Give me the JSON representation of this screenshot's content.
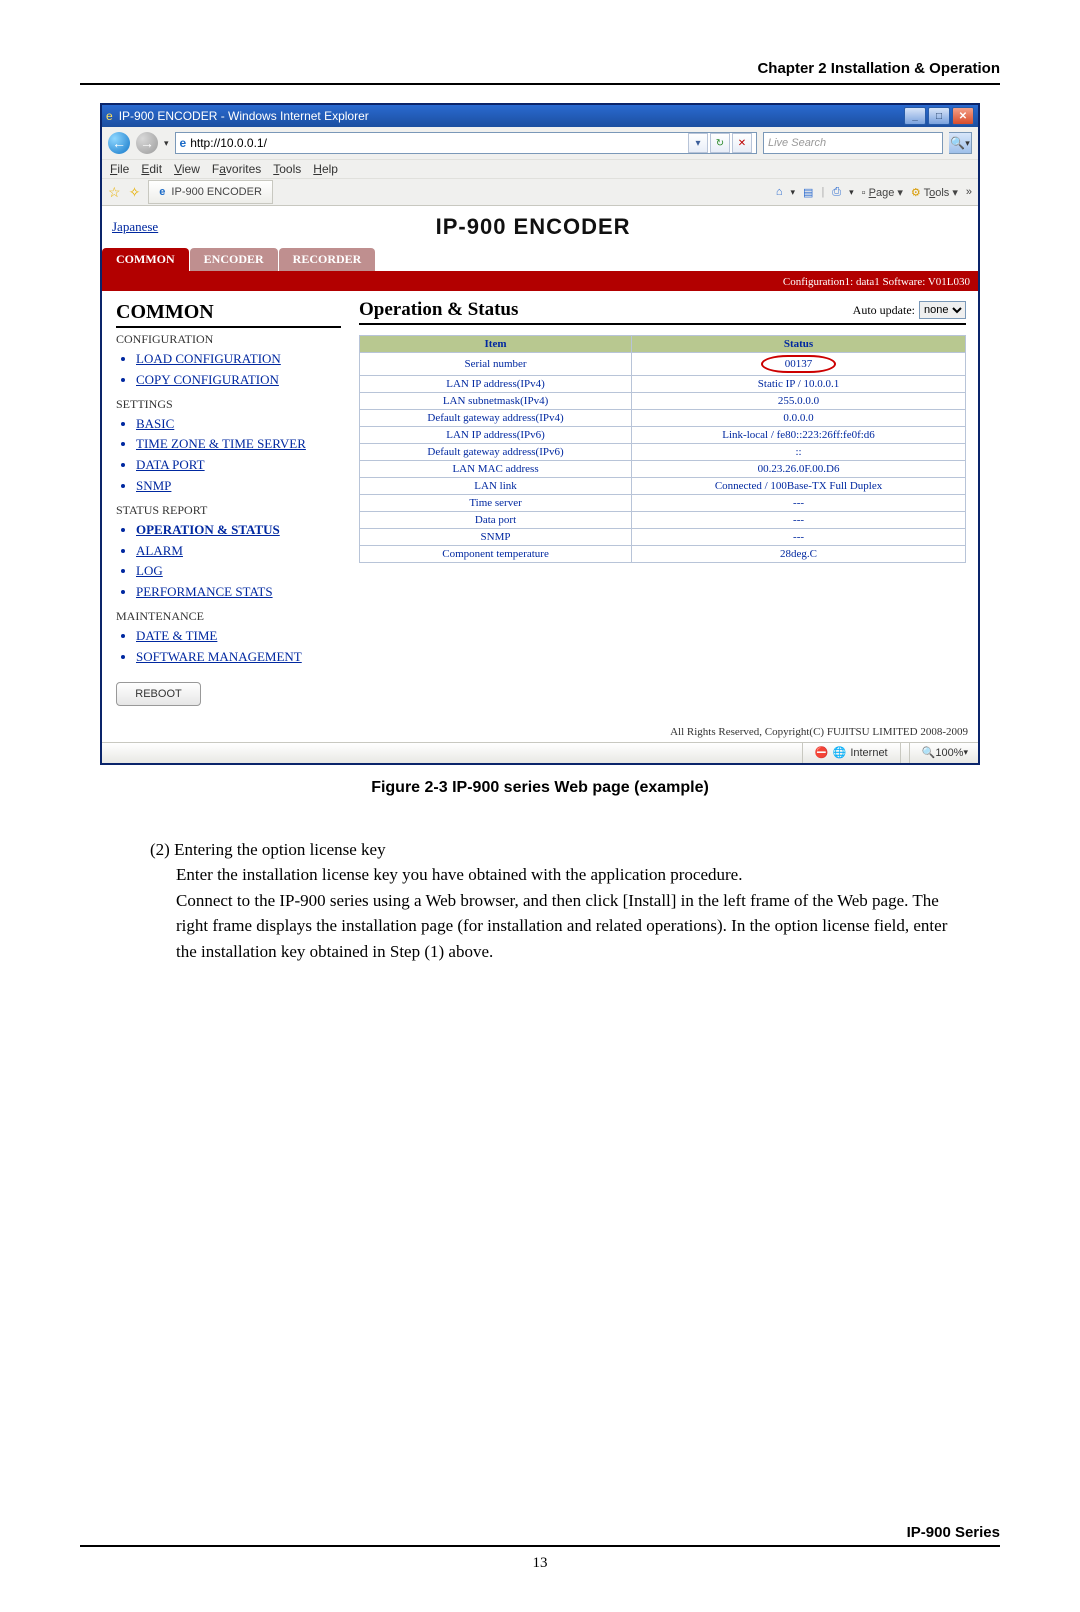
{
  "doc": {
    "chapter_header": "Chapter 2  Installation & Operation",
    "figure_caption": "Figure 2-3 IP-900 series Web page (example)",
    "step_title": "(2) Entering the option license key",
    "para1": "Enter the installation license key you have obtained with the application procedure.",
    "para2": "Connect to the IP-900 series using a Web browser, and then click [Install] in the left frame of the Web page.  The right frame displays the installation page (for installation and related operations).  In the option license field, enter the installation key obtained in Step (1) above.",
    "footer_series": "IP-900 Series",
    "page_number": "13"
  },
  "ie": {
    "title": "IP-900 ENCODER - Windows Internet Explorer",
    "url": "http://10.0.0.1/",
    "search_placeholder": "Live Search",
    "menus": {
      "file": "File",
      "edit": "Edit",
      "view": "View",
      "favorites": "Favorites",
      "tools": "Tools",
      "help": "Help"
    },
    "tab_label": "IP-900 ENCODER",
    "toolbar": {
      "home": "⌂",
      "feed": "▤",
      "print": "⎙",
      "page": "Page",
      "tools": "Tools"
    },
    "status_zone": "Internet",
    "zoom": "100%"
  },
  "webpage": {
    "lang_link": "Japanese",
    "title": "IP-900 ENCODER",
    "top_tabs": {
      "common": "COMMON",
      "encoder": "ENCODER",
      "recorder": "RECORDER"
    },
    "conf_bar": "Configuration1: data1 Software: V01L030",
    "sidebar": {
      "heading": "COMMON",
      "sec_configuration": "CONFIGURATION",
      "conf_items": [
        "LOAD CONFIGURATION",
        "COPY CONFIGURATION"
      ],
      "sec_settings": "SETTINGS",
      "settings_items": [
        "BASIC",
        "TIME ZONE & TIME SERVER",
        "DATA PORT",
        "SNMP"
      ],
      "sec_status": "STATUS REPORT",
      "status_items": [
        "OPERATION & STATUS",
        "ALARM",
        "LOG",
        "PERFORMANCE STATS"
      ],
      "sec_maint": "MAINTENANCE",
      "maint_items": [
        "DATE & TIME",
        "SOFTWARE MANAGEMENT"
      ],
      "reboot_label": "REBOOT"
    },
    "panel": {
      "title": "Operation & Status",
      "auto_update_label": "Auto update:",
      "auto_update_value": "none",
      "th_item": "Item",
      "th_status": "Status",
      "rows": [
        {
          "item": "Serial number",
          "status": "00137"
        },
        {
          "item": "LAN IP address(IPv4)",
          "status": "Static IP / 10.0.0.1"
        },
        {
          "item": "LAN subnetmask(IPv4)",
          "status": "255.0.0.0"
        },
        {
          "item": "Default gateway address(IPv4)",
          "status": "0.0.0.0"
        },
        {
          "item": "LAN IP address(IPv6)",
          "status": "Link-local / fe80::223:26ff:fe0f:d6"
        },
        {
          "item": "Default gateway address(IPv6)",
          "status": "::"
        },
        {
          "item": "LAN MAC address",
          "status": "00.23.26.0F.00.D6"
        },
        {
          "item": "LAN link",
          "status": "Connected / 100Base-TX Full Duplex"
        },
        {
          "item": "Time server",
          "status": "---"
        },
        {
          "item": "Data port",
          "status": "---"
        },
        {
          "item": "SNMP",
          "status": "---"
        },
        {
          "item": "Component temperature",
          "status": "28deg.C"
        }
      ]
    },
    "copyright": "All Rights Reserved, Copyright(C) FUJITSU LIMITED 2008-2009"
  }
}
